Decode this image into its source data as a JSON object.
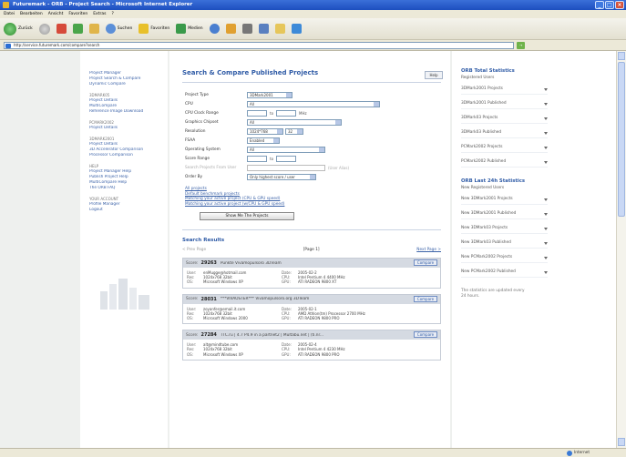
{
  "window": {
    "title": "Futuremark - ORB - Project Search - Microsoft Internet Explorer",
    "menu": [
      "Datei",
      "Bearbeiten",
      "Ansicht",
      "Favoriten",
      "Extras",
      "?"
    ]
  },
  "toolbar": {
    "back_label": "Zurück",
    "search_label": "Suchen",
    "favorites_label": "Favoriten",
    "media_label": "Medien"
  },
  "address": {
    "url": "http://service.futuremark.com/compare?search"
  },
  "statusbar": {
    "zone": "Internet"
  },
  "leftnav": {
    "sections": [
      {
        "header": "",
        "links": [
          "Project Manager",
          "Project Search & Compare",
          "Dynamic Compare"
        ]
      },
      {
        "header": "3DMARK05",
        "links": [
          "Project Details",
          "MultiCompare",
          "Reference Image Download"
        ]
      },
      {
        "header": "PCMARK2002",
        "links": [
          "Project Details"
        ]
      },
      {
        "header": "3DMARK2001",
        "links": [
          "Project Details",
          "3D Accelerator Comparison",
          "Processor Comparison"
        ]
      },
      {
        "header": "HELP",
        "links": [
          "Project Manager Help",
          "Publish Project Help",
          "MultiCompare Help",
          "The ORB FAQ"
        ]
      },
      {
        "header": "YOUR ACCOUNT",
        "links": [
          "Profile Manager",
          "Logout"
        ]
      }
    ]
  },
  "main": {
    "title": "Search & Compare Published Projects",
    "help_label": "Help",
    "form": {
      "project_type": {
        "label": "Project Type",
        "value": "3DMark2001"
      },
      "cpu": {
        "label": "CPU",
        "value": "All"
      },
      "cpu_clock": {
        "label": "CPU Clock Range",
        "to": "to",
        "units": "MHz"
      },
      "graphics_chipset": {
        "label": "Graphics Chipset",
        "value": "All"
      },
      "resolution": {
        "label": "Resolution",
        "value": "1024*768",
        "depth": "32"
      },
      "fsaa": {
        "label": "FSAA",
        "value": "Enabled"
      },
      "os": {
        "label": "Operating System",
        "value": "All"
      },
      "score_range": {
        "label": "Score Range",
        "to": "to"
      },
      "search_by_user": {
        "label": "Search Projects From User",
        "note": "(User Alias)"
      },
      "order_by": {
        "label": "Order By",
        "value": "Only highest score / user"
      }
    },
    "filters": [
      "All projects",
      "Default benchmark projects",
      "Matching your active project (CPU & GPU speed)",
      "Matching your active project (w/CPU & GPU speed)"
    ],
    "show_button": "Show Me The Projects"
  },
  "results": {
    "title": "Search Results",
    "prev": "< Prev Page",
    "page": "[Page 1]",
    "next": "Next Page >",
    "compare_label": "Compare",
    "score_label": "Score:",
    "keys": {
      "user": "User:",
      "res": "Res:",
      "os": "OS:",
      "date": "Date:",
      "cpu": "CPU:",
      "gpu": "GPU:"
    },
    "items": [
      {
        "score": "29263",
        "desc": "Punkte Vivamopulsoro 3DTeam",
        "user": "enMugge@hotmail.com",
        "res": "1024x768 32bit",
        "os": "Microsoft Windows XP",
        "date": "2005-02-2",
        "cpu": "Intel Pentium 4 4400 MHz",
        "gpu": "ATI RADEON 9800 XT"
      },
      {
        "score": "28031",
        "desc": "***VIVAOSTER*** Vivamopulsoro.org 3DTeam",
        "user": "zoyanfer@email.it.com",
        "res": "1024x768 32bit",
        "os": "Microsoft Windows 2000",
        "date": "2005-02-1",
        "cpu": "AMD Athlon(tm) Processor 2700 MHz",
        "gpu": "ATI RADEON 9800 PRO"
      },
      {
        "score": "27284",
        "desc": "TTC.ru | 4.7 P4.9 in a partnet2 | Multabu.net | (ti.nr...",
        "user": "alt@mindtube.com",
        "res": "1024x768 32bit",
        "os": "Microsoft Windows XP",
        "date": "2005-02-4",
        "cpu": "Intel Pentium 4 4230 MHz",
        "gpu": "ATI RADEON 9800 PRO"
      }
    ]
  },
  "rightbar": {
    "total_title": "ORB Total Statistics",
    "total_sub": "Registered Users",
    "total_items": [
      "3DMark2001 Projects",
      "3DMark2001 Published",
      "3DMark03 Projects",
      "3DMark03 Published",
      "PCMark2002 Projects",
      "PCMark2002 Published"
    ],
    "last_title": "ORB Last 24h Statistics",
    "last_sub": "New Registered Users",
    "last_items": [
      "New 3DMark2001 Projects",
      "New 3DMark2001 Published",
      "New 3DMark03 Projects",
      "New 3DMark03 Published",
      "New PCMark2002 Projects",
      "New PCMark2002 Published"
    ],
    "note": "The statistics are updated every 24 hours."
  }
}
